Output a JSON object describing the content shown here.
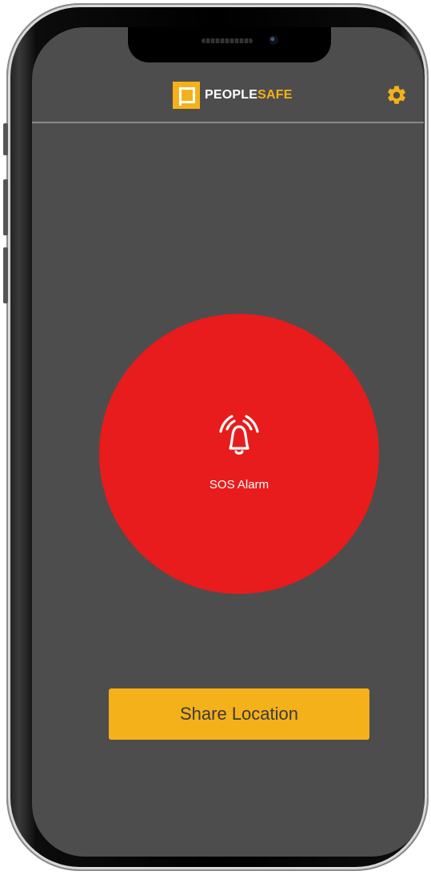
{
  "brand": {
    "name_part1": "PEOPLE",
    "name_part2": "SAFE",
    "accent_color": "#f4b11a"
  },
  "header": {
    "settings_icon": "gear-icon"
  },
  "sos": {
    "label": "SOS Alarm",
    "icon": "alarm-bell-icon",
    "color": "#e81c1c"
  },
  "actions": {
    "share_location_label": "Share Location"
  },
  "theme": {
    "background": "#4d4d4d"
  }
}
